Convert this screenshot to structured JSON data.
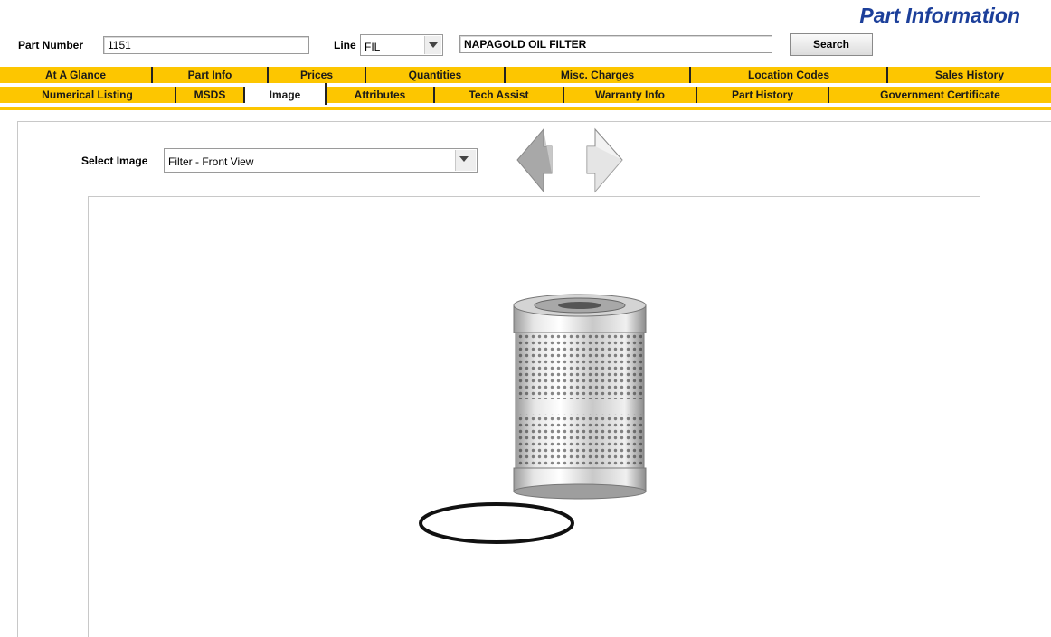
{
  "header": {
    "title": "Part Information"
  },
  "search_bar": {
    "part_number_label": "Part Number",
    "part_number_value": "1151",
    "line_label": "Line",
    "line_value": "FIL",
    "description_value": "NAPAGOLD OIL FILTER",
    "search_button": "Search"
  },
  "tabs_row1": [
    {
      "label": "At A Glance"
    },
    {
      "label": "Part Info"
    },
    {
      "label": "Prices"
    },
    {
      "label": "Quantities"
    },
    {
      "label": "Misc. Charges"
    },
    {
      "label": "Location Codes"
    },
    {
      "label": "Sales History"
    }
  ],
  "tabs_row2": [
    {
      "label": "Numerical Listing"
    },
    {
      "label": "MSDS"
    },
    {
      "label": "Image",
      "active": true
    },
    {
      "label": "Attributes"
    },
    {
      "label": "Tech Assist"
    },
    {
      "label": "Warranty Info"
    },
    {
      "label": "Part History"
    },
    {
      "label": "Government Certificate"
    }
  ],
  "image_panel": {
    "select_label": "Select Image",
    "selected_image": "Filter - Front View",
    "prev_icon": "left-arrow-icon",
    "next_icon": "right-arrow-icon"
  },
  "colors": {
    "tab_bg": "#fdc600",
    "title": "#1c3f9a"
  }
}
